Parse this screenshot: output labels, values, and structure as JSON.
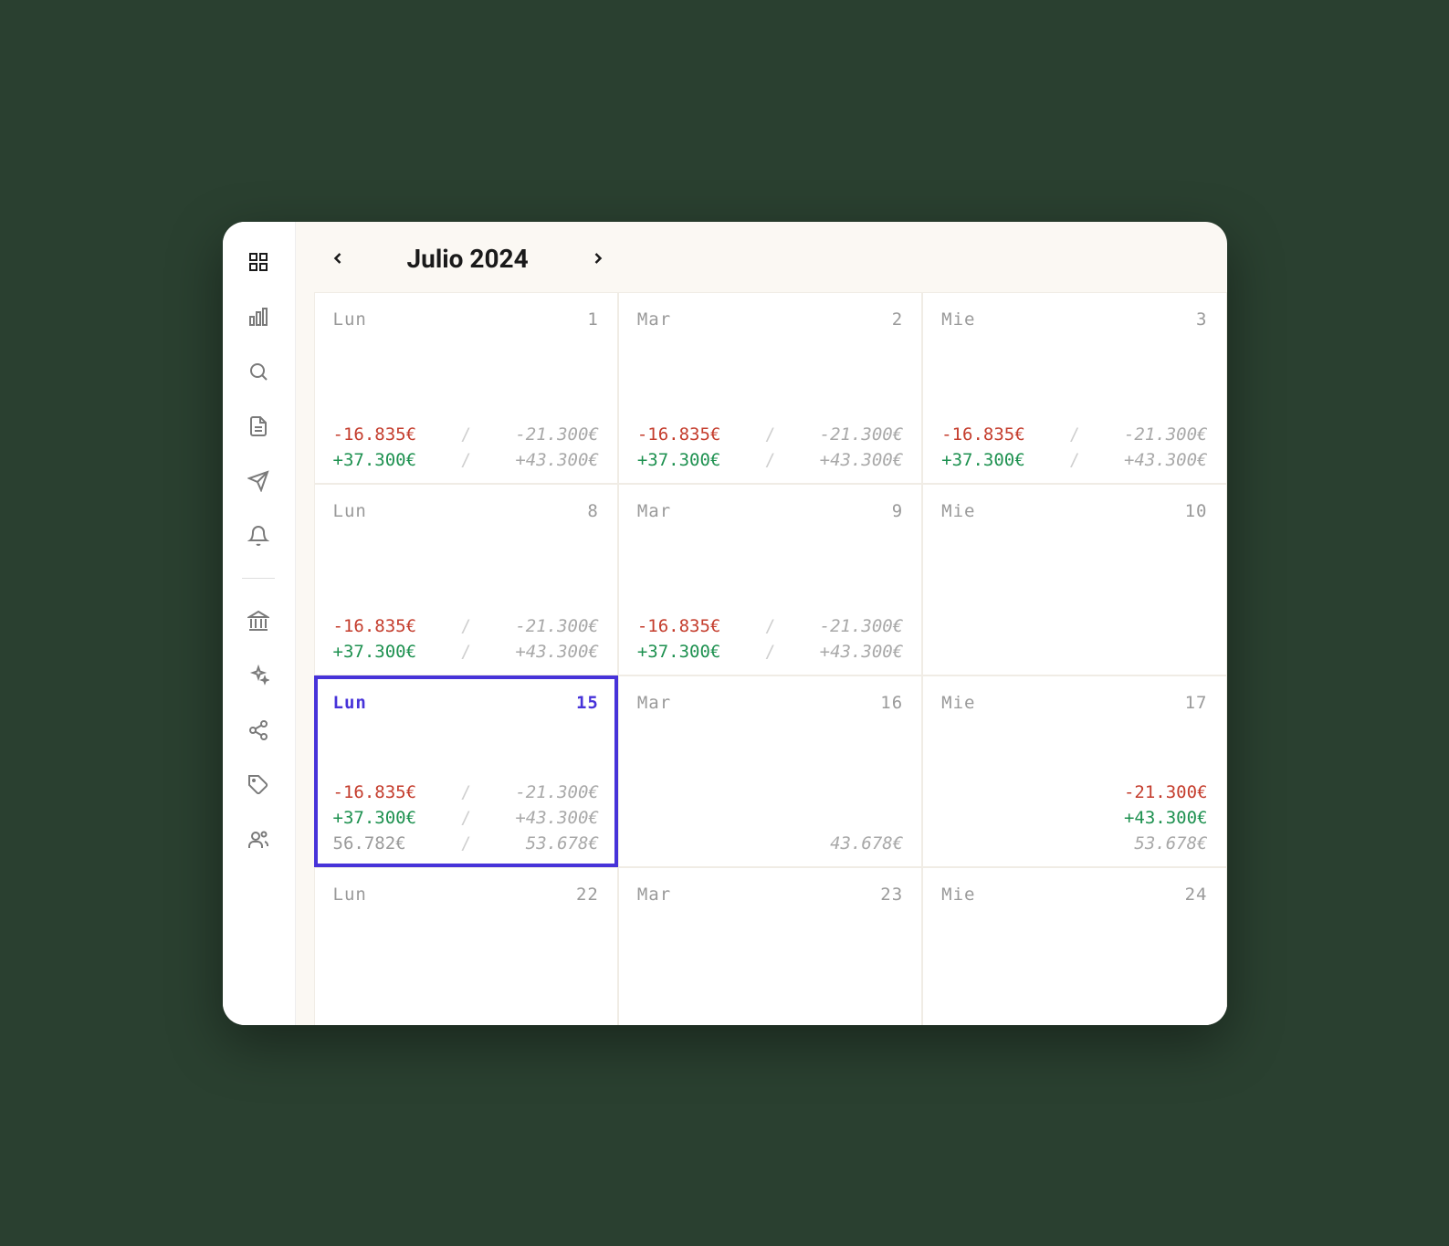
{
  "header": {
    "month_label": "Julio 2024"
  },
  "sidebar": {
    "icons": [
      {
        "name": "grid-icon",
        "active": true
      },
      {
        "name": "chart-icon",
        "active": false
      },
      {
        "name": "search-icon",
        "active": false
      },
      {
        "name": "document-icon",
        "active": false
      },
      {
        "name": "send-icon",
        "active": false
      },
      {
        "name": "bell-icon",
        "active": false
      },
      {
        "name": "bank-icon",
        "active": false
      },
      {
        "name": "sparkle-icon",
        "active": false
      },
      {
        "name": "share-icon",
        "active": false
      },
      {
        "name": "tag-icon",
        "active": false
      },
      {
        "name": "people-icon",
        "active": false
      }
    ]
  },
  "days": [
    {
      "dow": "Lun",
      "num": "1",
      "rows": [
        {
          "l": "-16.835€",
          "lcls": "neg",
          "r": "-21.300€"
        },
        {
          "l": "+37.300€",
          "lcls": "pos",
          "r": "+43.300€"
        }
      ]
    },
    {
      "dow": "Mar",
      "num": "2",
      "rows": [
        {
          "l": "-16.835€",
          "lcls": "neg",
          "r": "-21.300€"
        },
        {
          "l": "+37.300€",
          "lcls": "pos",
          "r": "+43.300€"
        }
      ]
    },
    {
      "dow": "Mie",
      "num": "3",
      "rows": [
        {
          "l": "-16.835€",
          "lcls": "neg",
          "r": "-21.300€"
        },
        {
          "l": "+37.300€",
          "lcls": "pos",
          "r": "+43.300€"
        }
      ]
    },
    {
      "dow": "Lun",
      "num": "8",
      "rows": [
        {
          "l": "-16.835€",
          "lcls": "neg",
          "r": "-21.300€"
        },
        {
          "l": "+37.300€",
          "lcls": "pos",
          "r": "+43.300€"
        }
      ]
    },
    {
      "dow": "Mar",
      "num": "9",
      "rows": [
        {
          "l": "-16.835€",
          "lcls": "neg",
          "r": "-21.300€"
        },
        {
          "l": "+37.300€",
          "lcls": "pos",
          "r": "+43.300€"
        }
      ]
    },
    {
      "dow": "Mie",
      "num": "10",
      "rows": []
    },
    {
      "dow": "Lun",
      "num": "15",
      "selected": true,
      "rows": [
        {
          "l": "-16.835€",
          "lcls": "neg",
          "r": "-21.300€"
        },
        {
          "l": "+37.300€",
          "lcls": "pos",
          "r": "+43.300€"
        },
        {
          "l": "56.782€",
          "lcls": "neutral",
          "r": "53.678€"
        }
      ]
    },
    {
      "dow": "Mar",
      "num": "16",
      "rows": [
        {
          "l": "",
          "lcls": "",
          "r": ""
        },
        {
          "l": "",
          "lcls": "",
          "r": ""
        },
        {
          "l": "",
          "lcls": "",
          "r": "43.678€",
          "single_right": true
        }
      ]
    },
    {
      "dow": "Mie",
      "num": "17",
      "rows": [
        {
          "l": "",
          "lcls": "",
          "r": "-21.300€",
          "rcls": "neg",
          "single_right": true
        },
        {
          "l": "",
          "lcls": "",
          "r": "+43.300€",
          "rcls": "pos",
          "single_right": true
        },
        {
          "l": "",
          "lcls": "",
          "r": "53.678€",
          "single_right": true
        }
      ]
    },
    {
      "dow": "Lun",
      "num": "22",
      "short": true,
      "rows": []
    },
    {
      "dow": "Mar",
      "num": "23",
      "short": true,
      "rows": []
    },
    {
      "dow": "Mie",
      "num": "24",
      "short": true,
      "rows": []
    }
  ]
}
